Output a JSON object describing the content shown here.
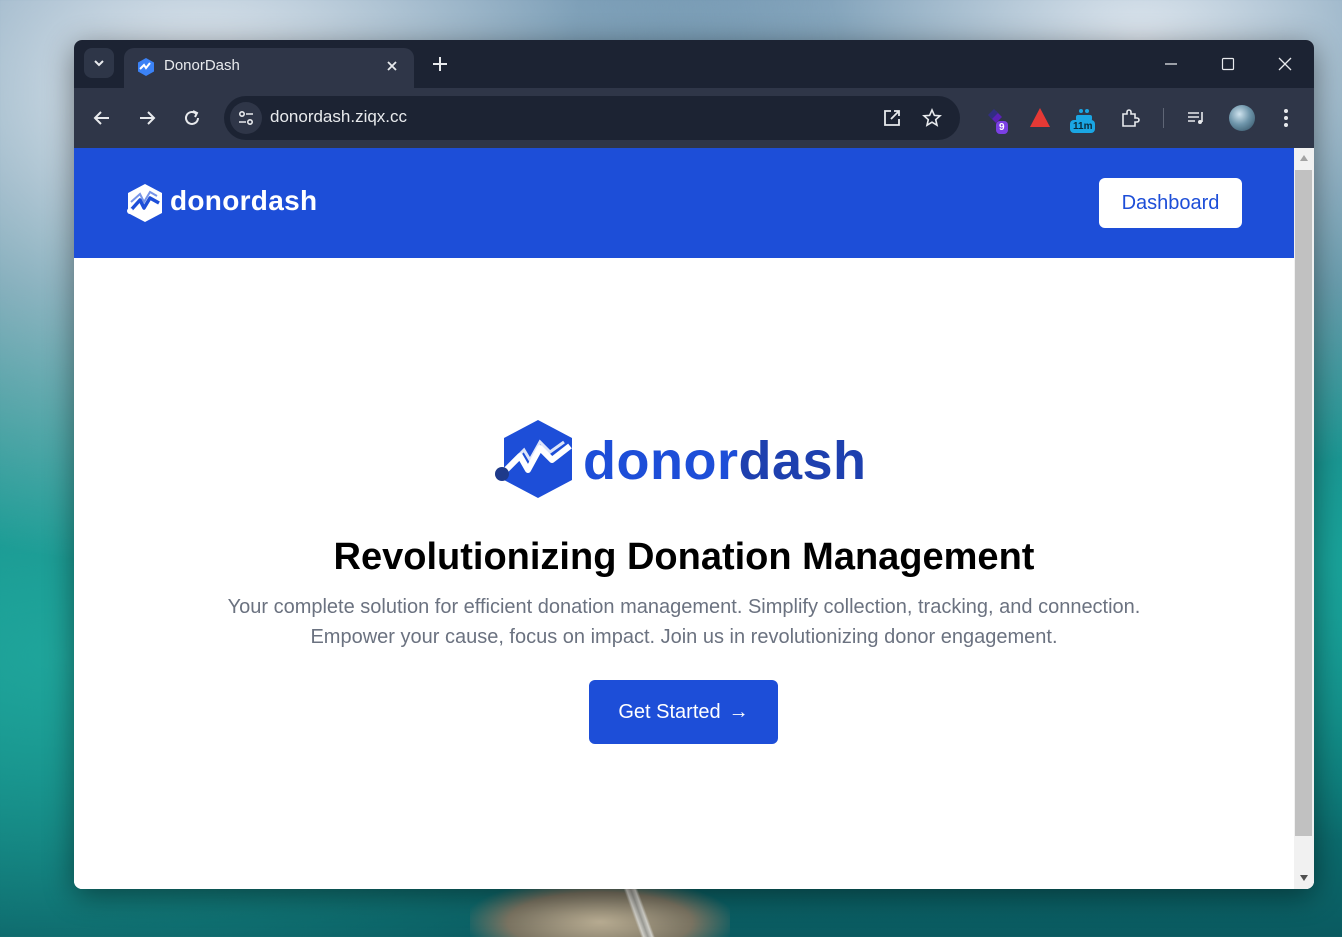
{
  "browser": {
    "tab": {
      "title": "DonorDash"
    },
    "address_bar": {
      "url": "donordash.ziqx.cc"
    },
    "extensions": [
      {
        "icon": "extension-purple-icon",
        "badge": "9",
        "badge_color": "#7b3fe4"
      },
      {
        "icon": "extension-red-triangle-icon"
      },
      {
        "icon": "extension-timer-icon",
        "badge": "11m",
        "badge_color": "#1aa6e4"
      },
      {
        "icon": "extensions-puzzle-icon"
      }
    ]
  },
  "site": {
    "brand": "donordash",
    "brand_parts": {
      "donor": "donor",
      "dash": "dash"
    },
    "nav": {
      "dashboard_label": "Dashboard"
    },
    "hero": {
      "title": "Revolutionizing Donation Management",
      "subtitle_line1": "Your complete solution for efficient donation management. Simplify collection, tracking, and connection.",
      "subtitle_line2": "Empower your cause, focus on impact. Join us in revolutionizing donor engagement.",
      "cta_label": "Get Started",
      "cta_arrow": "→"
    }
  },
  "colors": {
    "primary": "#1d4ed8",
    "primary_dark": "#1e40af",
    "chrome_dark": "#1c2333",
    "chrome_toolbar": "#2f3648",
    "subtitle_text": "#6b7280"
  }
}
